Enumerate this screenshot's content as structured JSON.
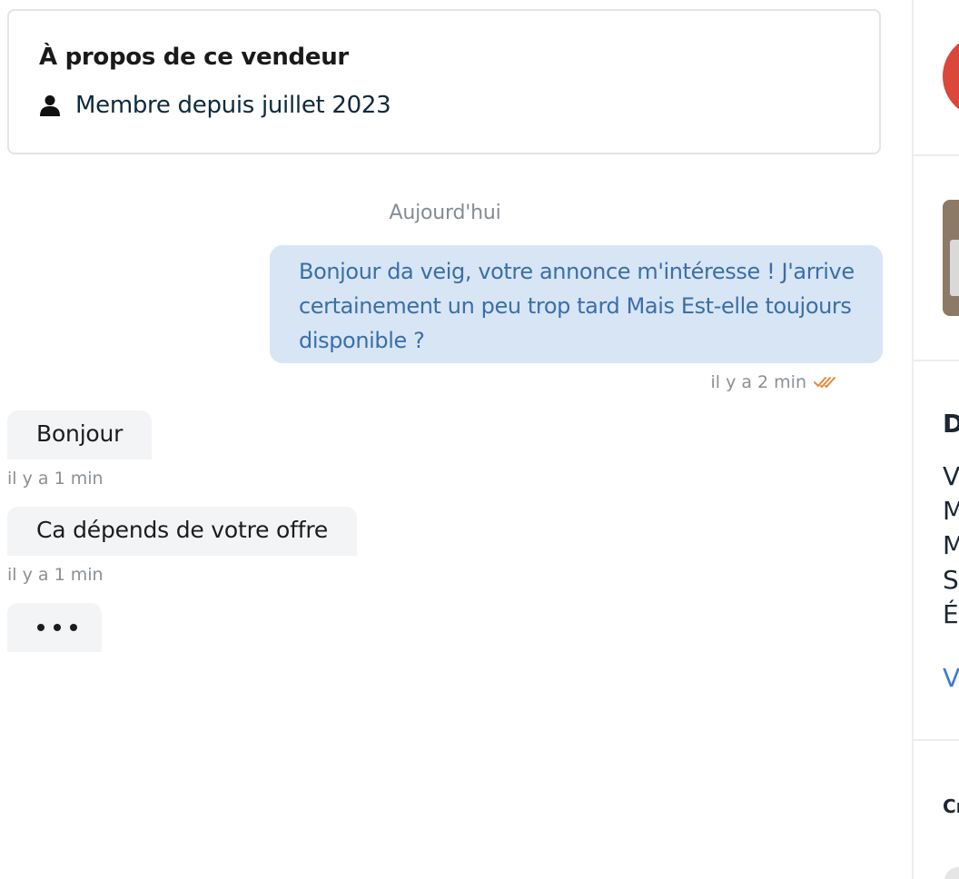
{
  "seller": {
    "title": "À propos de ce vendeur",
    "member_since": "Membre depuis juillet 2023",
    "icon": "user-icon"
  },
  "conversation": {
    "date_separator": "Aujourd'hui",
    "messages": [
      {
        "direction": "outgoing",
        "text": "Bonjour da veig, votre annonce m'intéresse ! J'arrive certainement un peu trop tard Mais Est-elle toujours disponible ?",
        "time": "il y a 2 min",
        "status_icon": "double-check-icon",
        "status_color": "#e8873a"
      },
      {
        "direction": "incoming",
        "text": "Bonjour",
        "time": "il y a 1 min"
      },
      {
        "direction": "incoming",
        "text": "Ca dépends de votre offre",
        "time": "il y a 1 min"
      }
    ],
    "typing_indicator": "•••"
  },
  "side_panel": {
    "heading_letter": "D",
    "list_letters": [
      "V",
      "M",
      "M",
      "S",
      "É"
    ],
    "link_letter": "V",
    "small_heading": "Cr",
    "avatar_color": "#d9483b"
  },
  "colors": {
    "outgoing_bubble": "#d7e5f5",
    "outgoing_text": "#3a6fa8",
    "incoming_bubble": "#f3f4f6",
    "meta_text": "#8a9096"
  }
}
